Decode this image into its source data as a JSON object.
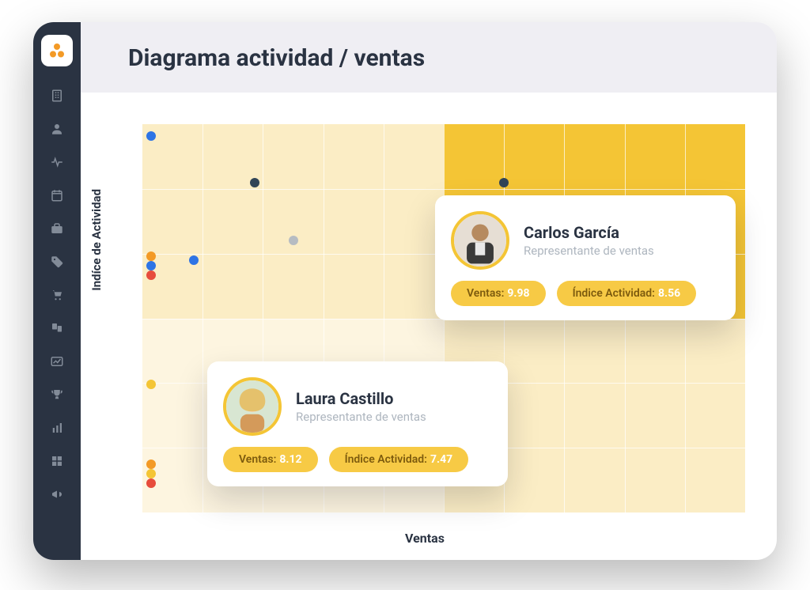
{
  "header": {
    "title": "Diagrama actividad / ventas"
  },
  "axes": {
    "x": "Ventas",
    "y": "Indíce de Actividad"
  },
  "sidebar": {
    "icons": [
      "building-icon",
      "user-icon",
      "pulse-icon",
      "calendar-icon",
      "briefcase-icon",
      "tag-icon",
      "cart-icon",
      "product-icon",
      "chart-line-icon",
      "trophy-icon",
      "bar-chart-icon",
      "matrix-icon",
      "megaphone-icon"
    ]
  },
  "colors": {
    "accent": "#f4c535",
    "dot_blue": "#2e74e5",
    "dot_navy": "#314557",
    "dot_orange": "#f39a26",
    "dot_red": "#e74c3c",
    "dot_yellow": "#f4c535",
    "dot_gray": "#b6bcc2"
  },
  "chart_data": {
    "type": "scatter",
    "xlabel": "Ventas",
    "ylabel": "Indíce de Actividad",
    "xlim": [
      0,
      14
    ],
    "ylim": [
      0,
      10
    ],
    "grid": true,
    "points": [
      {
        "x": 0.2,
        "y": 9.7,
        "color": "#2e74e5"
      },
      {
        "x": 0.2,
        "y": 6.6,
        "color": "#f39a26"
      },
      {
        "x": 0.2,
        "y": 6.35,
        "color": "#2e74e5"
      },
      {
        "x": 0.2,
        "y": 6.1,
        "color": "#e74c3c"
      },
      {
        "x": 0.2,
        "y": 3.3,
        "color": "#f4c535"
      },
      {
        "x": 0.2,
        "y": 1.25,
        "color": "#f39a26"
      },
      {
        "x": 0.2,
        "y": 1.0,
        "color": "#f4c535"
      },
      {
        "x": 0.2,
        "y": 0.75,
        "color": "#e74c3c"
      },
      {
        "x": 1.2,
        "y": 6.5,
        "color": "#2e74e5"
      },
      {
        "x": 2.6,
        "y": 8.5,
        "color": "#314557"
      },
      {
        "x": 3.5,
        "y": 7.0,
        "color": "#b6bcc2"
      },
      {
        "x": 8.4,
        "y": 8.5,
        "color": "#314557"
      }
    ]
  },
  "cards": [
    {
      "name": "Carlos García",
      "role": "Representante de ventas",
      "metrics": [
        {
          "label": "Ventas:",
          "value": "9.98"
        },
        {
          "label": "Índice Actividad:",
          "value": "8.56"
        }
      ]
    },
    {
      "name": "Laura Castillo",
      "role": "Representante de ventas",
      "metrics": [
        {
          "label": "Ventas:",
          "value": "8.12"
        },
        {
          "label": "Índice Actividad:",
          "value": "7.47"
        }
      ]
    }
  ]
}
